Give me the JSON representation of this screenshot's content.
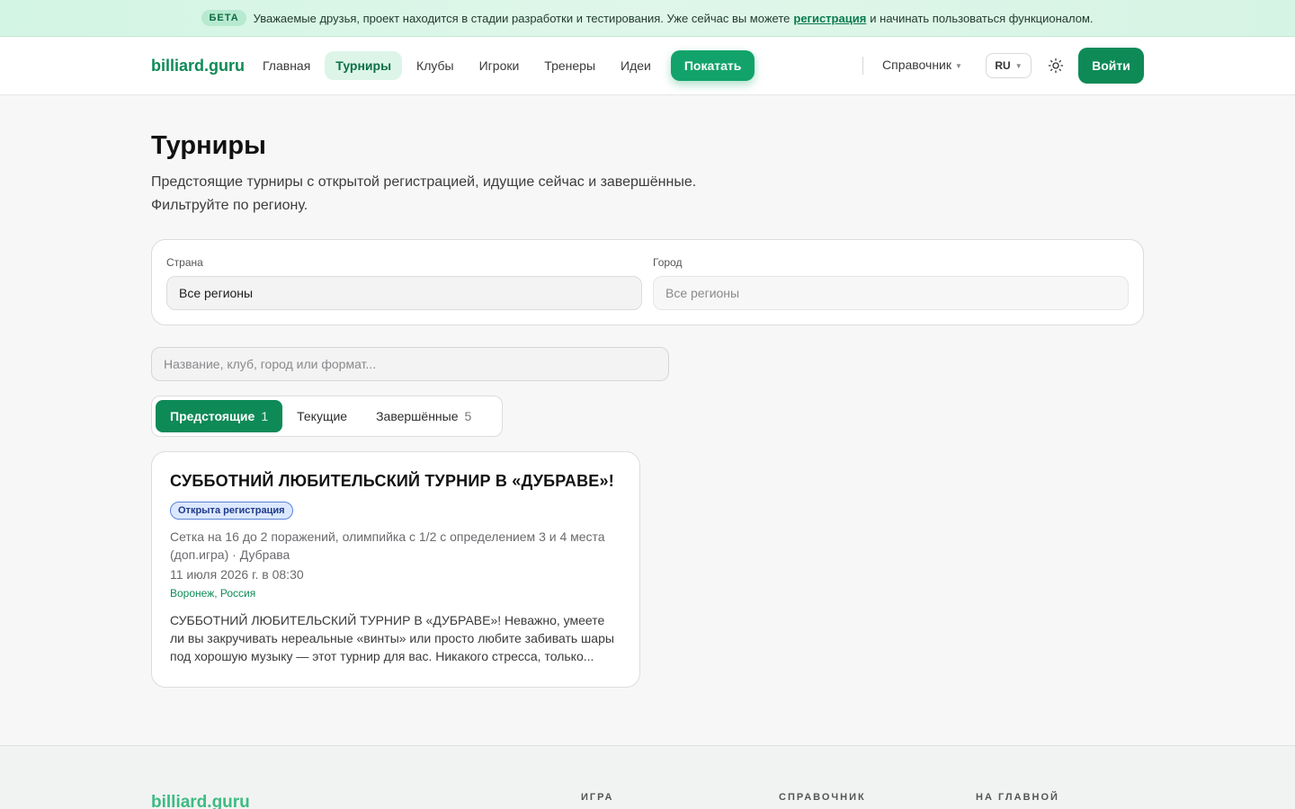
{
  "banner": {
    "badge": "БЕТА",
    "text_before": "Уважаемые друзья, проект находится в стадии разработки и тестирования. Уже сейчас вы можете",
    "link": "регистрация",
    "text_after": "и начинать пользоваться функционалом."
  },
  "header": {
    "logo": "billiard.guru",
    "nav": [
      "Главная",
      "Турниры",
      "Клубы",
      "Игроки",
      "Тренеры",
      "Идеи"
    ],
    "play_label": "Покатать",
    "reference_label": "Справочник",
    "lang_label": "RU",
    "login_label": "Войти"
  },
  "main": {
    "title": "Турниры",
    "description": "Предстоящие турниры с открытой регистрацией, идущие сейчас и завершённые. Фильтруйте по региону.",
    "filters": {
      "country_label": "Страна",
      "country_value": "Все регионы",
      "city_label": "Город",
      "city_value": "Все регионы"
    },
    "search": {
      "placeholder": "Название, клуб, город или формат..."
    },
    "tabs": [
      {
        "label": "Предстоящие",
        "count": "1"
      },
      {
        "label": "Текущие",
        "count": ""
      },
      {
        "label": "Завершённые",
        "count": "5"
      }
    ],
    "tournament": {
      "title": "СУББОТНИЙ ЛЮБИТЕЛЬСКИЙ ТУРНИР В «ДУБРАВЕ»!",
      "badge": "Открыта регистрация",
      "format": "Сетка на 16 до 2 поражений, олимпийка с 1/2 с определением 3 и 4 места (доп.игра) · Дубрава",
      "date": "11 июля 2026 г. в 08:30",
      "location": "Воронеж, Россия",
      "description": "СУББОТНИЙ ЛЮБИТЕЛЬСКИЙ ТУРНИР В «ДУБРАВЕ»! Неважно, умеете ли вы закручивать нереальные «винты» или просто любите забивать шары под хорошую музыку — этот турнир для вас. Никакого стресса, только..."
    }
  },
  "footer": {
    "logo": "billiard.guru",
    "columns": [
      "ИГРА",
      "СПРАВОЧНИК",
      "НА ГЛАВНОЙ"
    ]
  },
  "colors": {
    "brand": "#0e8a57",
    "accent": "#12a36a",
    "badge_blue": "#dbe8ff"
  }
}
